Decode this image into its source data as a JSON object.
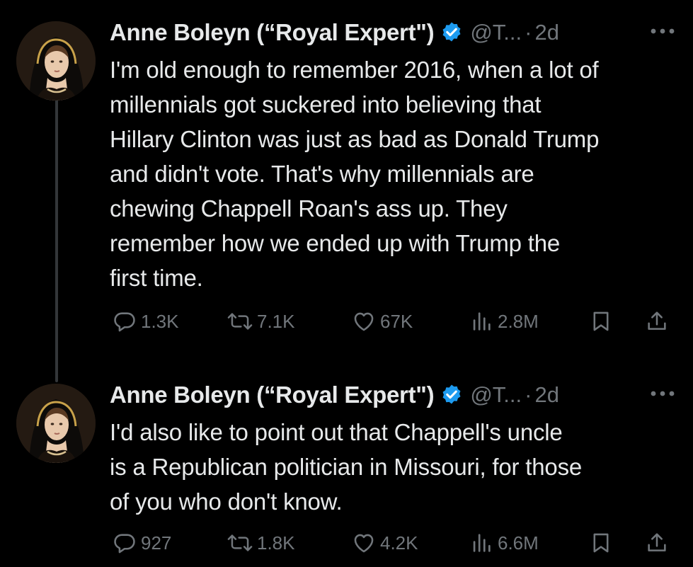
{
  "tweets": [
    {
      "author": {
        "name": "Anne Boleyn (“Royal Expert\")",
        "handle": "@T...",
        "time": "2d"
      },
      "separator": "·",
      "text": "I'm old enough to remember 2016, when a lot of\nmillennials got suckered into believing that\nHillary Clinton was just as bad as Donald Trump\nand didn't vote. That's why millennials are\nchewing Chappell Roan's ass up. They\nremember how we ended up with Trump the\nfirst time.",
      "stats": {
        "replies": "1.3K",
        "reposts": "7.1K",
        "likes": "67K",
        "views": "2.8M"
      }
    },
    {
      "author": {
        "name": "Anne Boleyn (“Royal Expert\")",
        "handle": "@T...",
        "time": "2d"
      },
      "separator": "·",
      "text": "I'd also like to point out that Chappell's uncle\nis a Republican politician in Missouri, for those\nof you who don't know.",
      "stats": {
        "replies": "927",
        "reposts": "1.8K",
        "likes": "4.2K",
        "views": "6.6M"
      }
    }
  ],
  "icons": {
    "verified": "verified-badge-icon",
    "more": "more-options-icon",
    "reply": "reply-icon",
    "repost": "repost-icon",
    "like": "like-icon",
    "views": "views-icon",
    "bookmark": "bookmark-icon",
    "share": "share-icon"
  },
  "colors": {
    "background": "#000000",
    "text": "#e7e9ea",
    "secondary": "#71767b",
    "verified": "#1d9bf0",
    "thread_line": "#333639"
  }
}
